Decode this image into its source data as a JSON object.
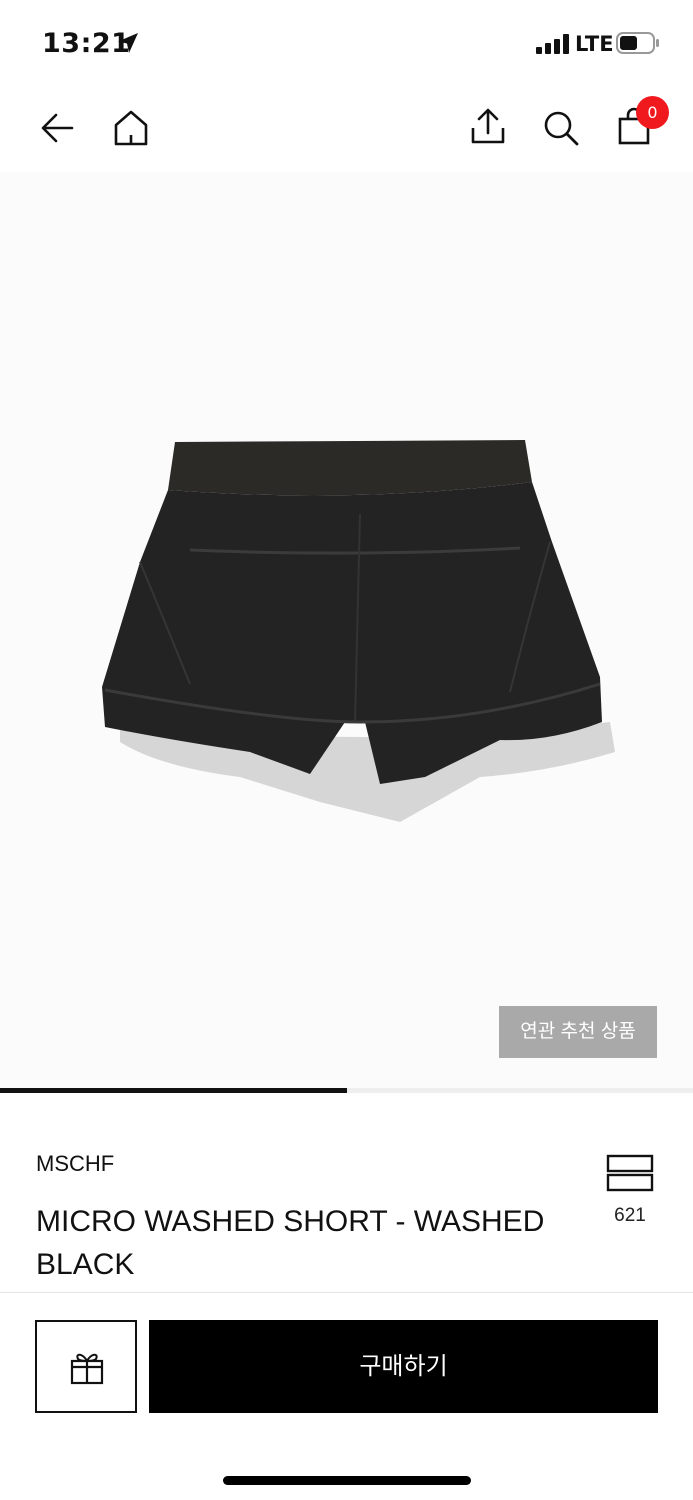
{
  "status_bar": {
    "time": "13:21",
    "carrier": "LTE"
  },
  "nav": {
    "cart_count": "0"
  },
  "gallery": {
    "related_label": "연관 추천 상품",
    "progress_fraction": 0.5
  },
  "product": {
    "brand": "MSCHF",
    "name": "MICRO WASHED SHORT - WASHED BLACK",
    "like_count": "621"
  },
  "bottom_bar": {
    "buy_label": "구매하기"
  },
  "icons": {
    "back": "arrow-left-icon",
    "home": "home-icon",
    "share": "share-icon",
    "search": "search-icon",
    "bag": "shopping-bag-icon",
    "like": "wishlist-icon",
    "gift": "gift-icon"
  },
  "colors": {
    "badge": "#f0191e",
    "related_button": "#a9a9a9",
    "buy_button": "#000000"
  }
}
